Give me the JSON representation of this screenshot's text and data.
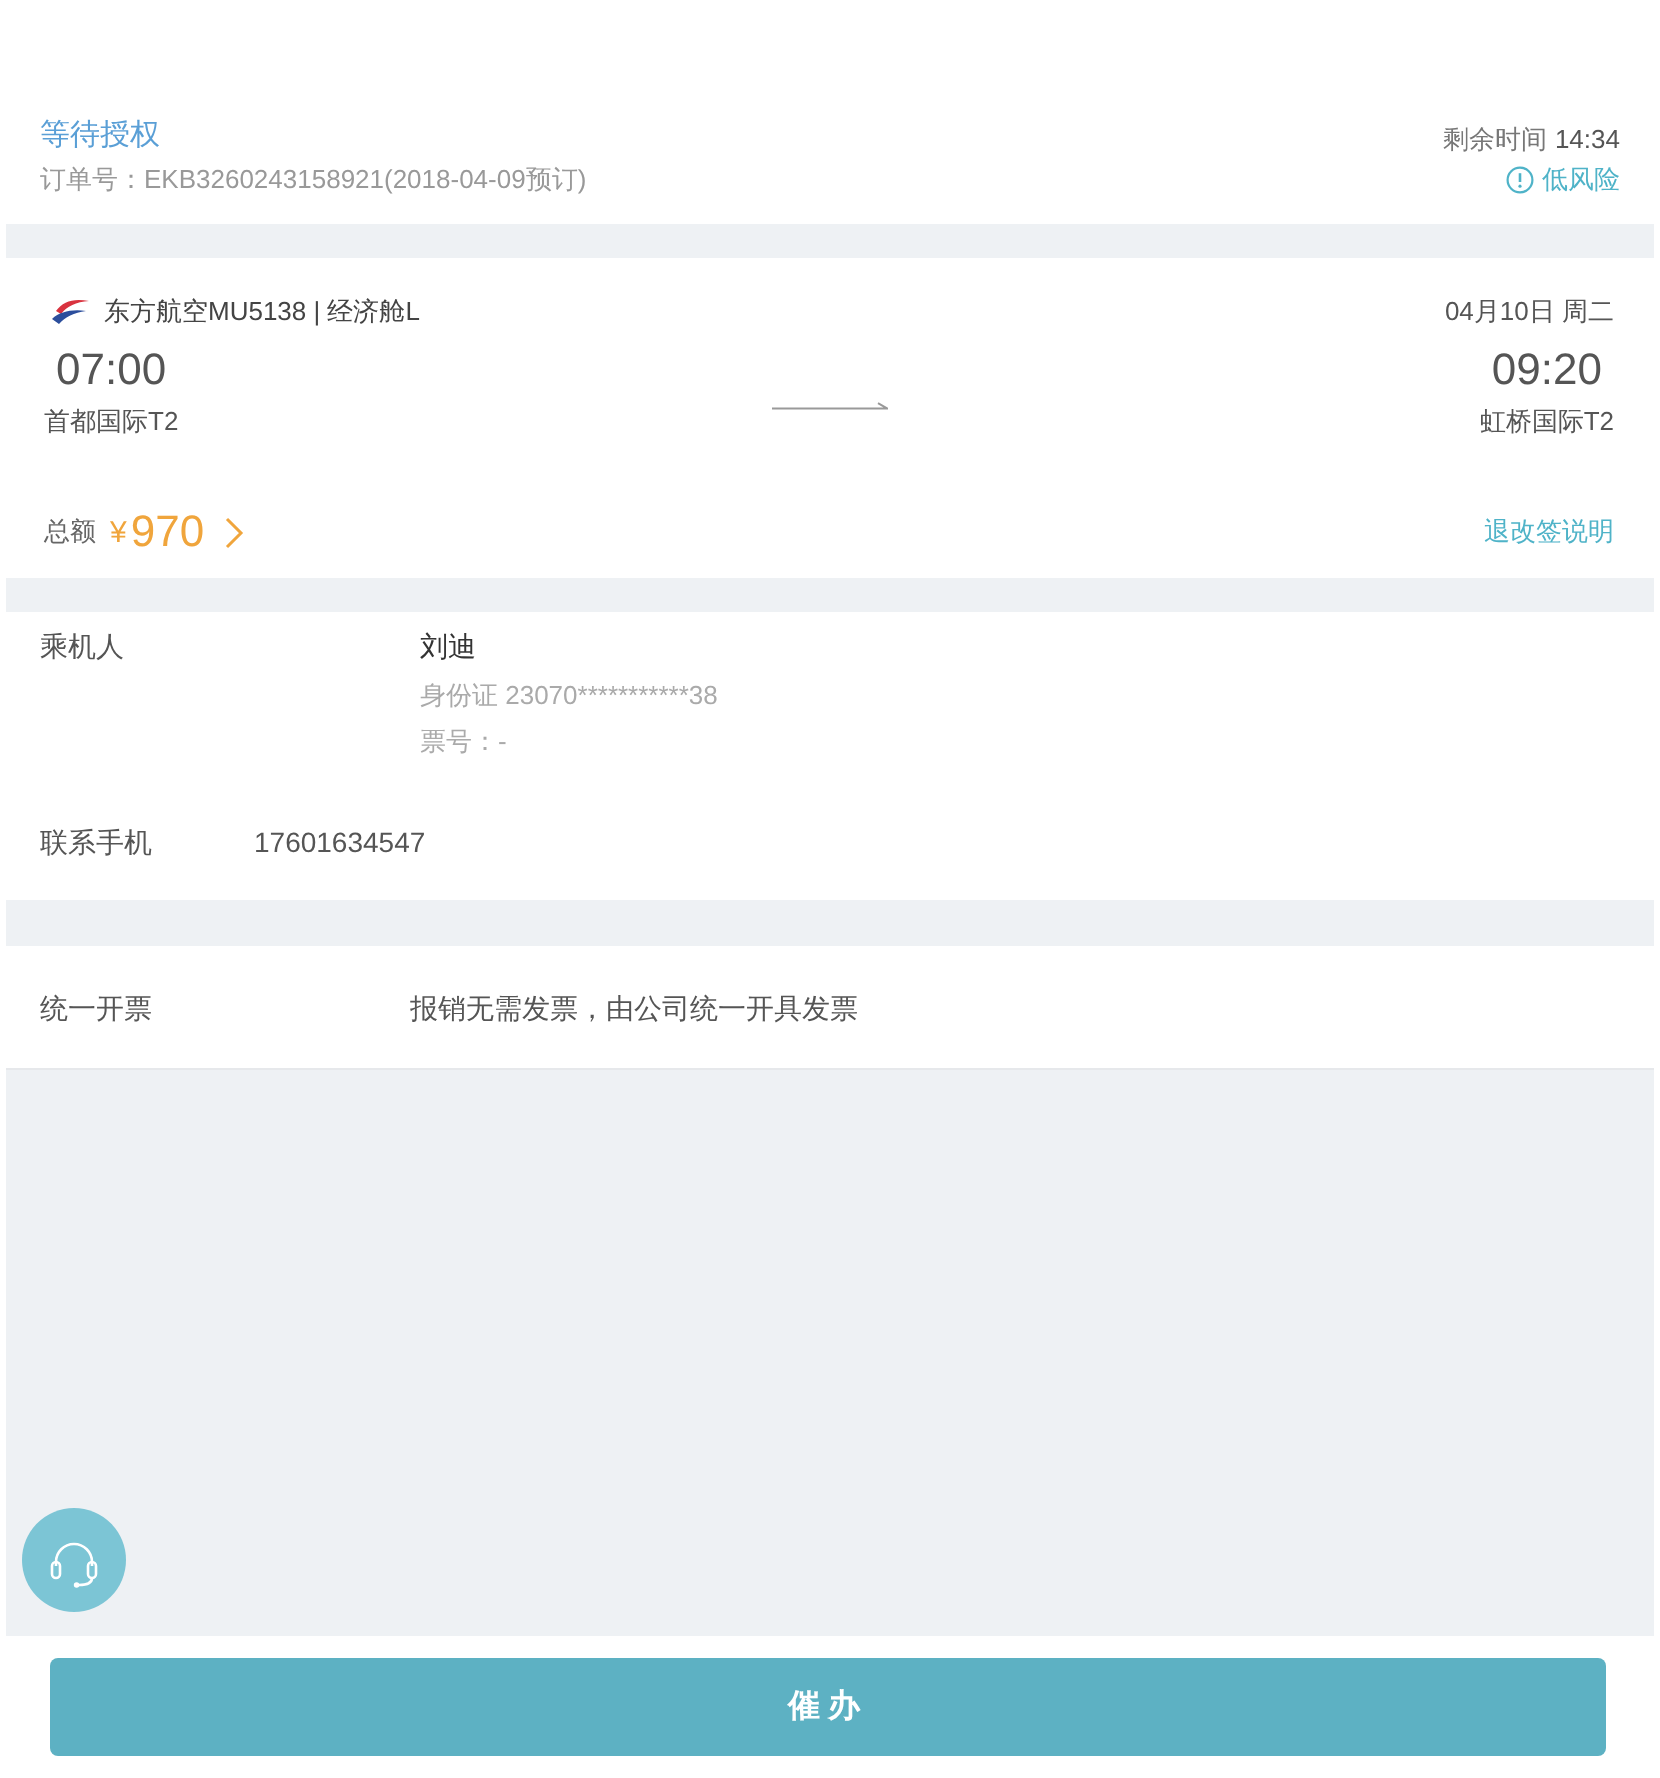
{
  "status": {
    "title": "等待授权",
    "order": "订单号：EKB3260243158921(2018-04-09预订)",
    "remaining_label": "剩余时间",
    "remaining_time": "14:34",
    "risk": "低风险"
  },
  "flight": {
    "airline": "东方航空MU5138 | 经济舱L",
    "date": "04月10日 周二",
    "departure": {
      "time": "07:00",
      "airport": "首都国际T2"
    },
    "arrival": {
      "time": "09:20",
      "airport": "虹桥国际T2"
    }
  },
  "total": {
    "label": "总额",
    "currency": "¥",
    "amount": "970",
    "policy_link": "退改签说明"
  },
  "passenger": {
    "label": "乘机人",
    "name": "刘迪",
    "id": "身份证 23070***********38",
    "ticket": "票号：-"
  },
  "contact": {
    "label": "联系手机",
    "phone": "17601634547"
  },
  "invoice": {
    "label": "统一开票",
    "text": "报销无需发票，由公司统一开具发票"
  },
  "action": {
    "button": "催办"
  }
}
